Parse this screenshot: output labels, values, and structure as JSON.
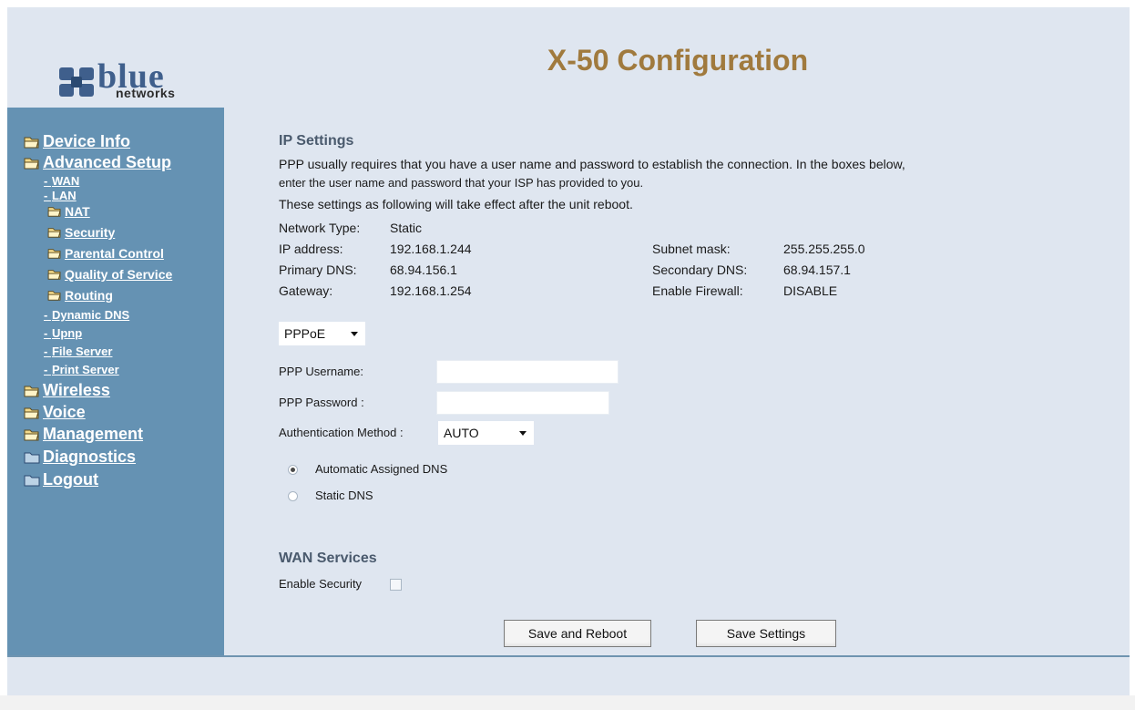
{
  "header": {
    "logo_main": "blue",
    "logo_sub": "networks",
    "title": "X-50 Configuration"
  },
  "sidebar": {
    "device_info": "Device Info",
    "advanced_setup": "Advanced Setup",
    "wan": "WAN",
    "lan": "LAN",
    "nat": "NAT",
    "security": "Security",
    "parental_control": "Parental Control",
    "quality_of_service": "Quality of Service",
    "routing": "Routing",
    "dynamic_dns": "Dynamic DNS",
    "upnp": "Upnp",
    "file_server": "File Server",
    "print_server": "Print Server",
    "wireless": "Wireless",
    "voice": "Voice",
    "management": "Management",
    "diagnostics": "Diagnostics",
    "logout": "Logout"
  },
  "ip_settings": {
    "title": "IP Settings",
    "desc_line1": "PPP usually requires that you have a user name and password to establish the connection. In the boxes below,",
    "desc_line2": "enter the user name and password that your ISP has provided to you.",
    "reboot_note": "These settings as following will take effect after the unit reboot.",
    "network_type_label": "Network Type:",
    "network_type_value": "Static",
    "ip_address_label": "IP address:",
    "ip_address_value": "192.168.1.244",
    "subnet_mask_label": "Subnet mask:",
    "subnet_mask_value": "255.255.255.0",
    "primary_dns_label": "Primary DNS:",
    "primary_dns_value": "68.94.156.1",
    "secondary_dns_label": "Secondary DNS:",
    "secondary_dns_value": "68.94.157.1",
    "gateway_label": "Gateway:",
    "gateway_value": "192.168.1.254",
    "firewall_label": "Enable Firewall:",
    "firewall_value": "DISABLE"
  },
  "form": {
    "connection_type": "PPPoE",
    "username_label": "PPP Username:",
    "username_value": "",
    "password_label": "PPP Password :",
    "password_value": "",
    "auth_label": "Authentication Method :",
    "auth_value": "AUTO",
    "dns_auto_label": "Automatic Assigned DNS",
    "dns_static_label": "Static DNS"
  },
  "wan_services": {
    "title": "WAN Services",
    "enable_security_label": "Enable Security"
  },
  "buttons": {
    "save_reboot": "Save and Reboot",
    "save_settings": "Save Settings"
  },
  "colors": {
    "sidebar_bg": "#6592b3",
    "page_bg": "#dfe6f0",
    "title_color": "#a07a3e"
  }
}
